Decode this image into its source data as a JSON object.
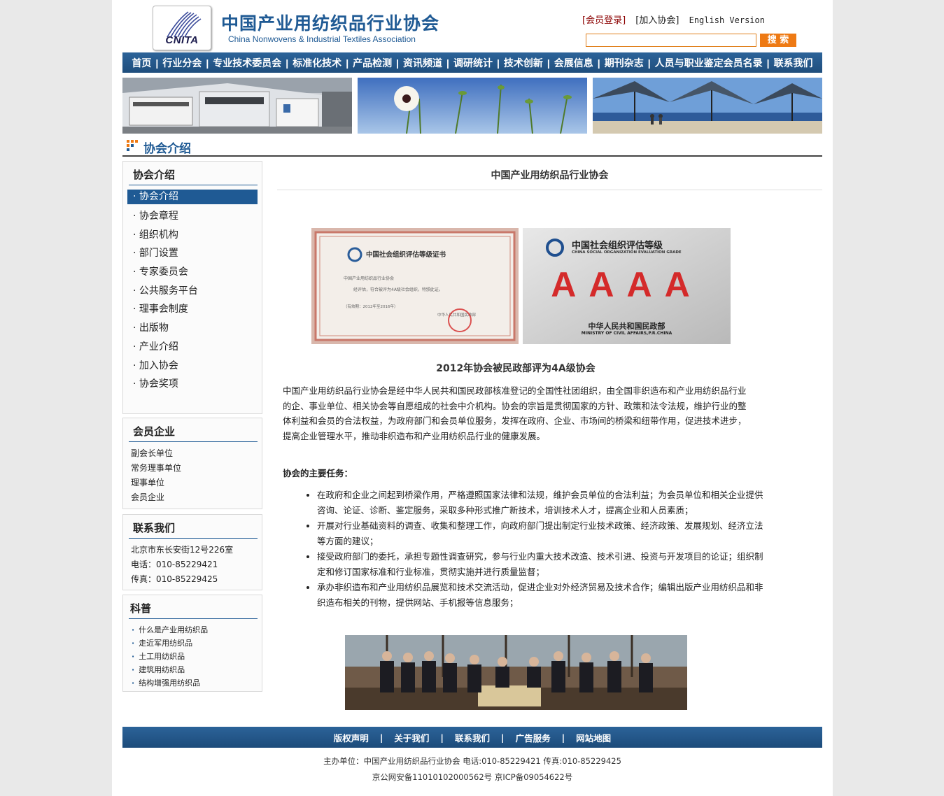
{
  "header": {
    "logo_text": "CNITA",
    "title": "中国产业用纺织品行业协会",
    "subtitle": "China Nonwovens & Industrial Textiles Association",
    "login_link": "[会员登录]",
    "join_link": "[加入协会]",
    "english_link": "English Version",
    "search_placeholder": "",
    "search_button": "搜 索"
  },
  "nav": [
    "首页",
    "行业分会",
    "专业技术委员会",
    "标准化技术",
    "产品检测",
    "资讯频道",
    "调研统计",
    "技术创新",
    "会展信息",
    "期刊杂志",
    "人员与职业鉴定会员名录",
    "联系我们"
  ],
  "nav_separator": "|",
  "section_title": "协会介绍",
  "sidebar": {
    "about": {
      "title": "协会介绍",
      "items": [
        "· 协会介绍",
        "· 协会章程",
        "· 组织机构",
        "· 部门设置",
        "· 专家委员会",
        "· 公共服务平台",
        "· 理事会制度",
        "· 出版物",
        "· 产业介绍",
        "· 加入协会",
        "· 协会奖项"
      ]
    },
    "members": {
      "title": "会员企业",
      "items": [
        "副会长单位",
        "常务理事单位",
        "理事单位",
        "会员企业"
      ]
    },
    "contact": {
      "title": "联系我们",
      "address": "北京市东长安街12号226室",
      "phone": "电话：010-85229421",
      "fax": "传真：010-85229425"
    },
    "science": {
      "title": "科普",
      "items": [
        "什么是产业用纺织品",
        "走近军用纺织品",
        "土工用纺织品",
        "建筑用纺织品",
        "结构增强用纺织品"
      ]
    }
  },
  "main": {
    "title": "中国产业用纺织品行业协会",
    "cert_left": {
      "heading": "中国社会组织评估等级证书",
      "line1": "中国产业用纺织品行业协会",
      "line2": "经评估，符合被评为4A级社会组织，特颁此证。",
      "line3": "（有效期：2012年至2016年）",
      "issuer": "中华人民共和国民政部"
    },
    "cert_right": {
      "heading": "中国社会组织评估等级",
      "heading_en": "CHINA SOCIAL ORGANIZATION EVALUATION GRADE",
      "grade": "AAAA",
      "ministry": "中华人民共和国民政部",
      "ministry_en": "MINISTRY OF CIVIL AFFAIRS,P.R.CHINA"
    },
    "caption": "2012年协会被民政部评为4A级协会",
    "intro": "中国产业用纺织品行业协会是经中华人民共和国民政部核准登记的全国性社团组织，由全国非织造布和产业用纺织品行业的企、事业单位、相关协会等自愿组成的社会中介机构。协会的宗旨是贯彻国家的方针、政策和法令法规，维护行业的整体利益和会员的合法权益，为政府部门和会员单位服务，发挥在政府、企业、市场间的桥梁和纽带作用，促进技术进步，提高企业管理水平，推动非织造布和产业用纺织品行业的健康发展。",
    "tasks_title": "协会的主要任务：",
    "tasks": [
      "在政府和企业之间起到桥梁作用，严格遵照国家法律和法规，维护会员单位的合法利益；为会员单位和相关企业提供咨询、论证、诊断、鉴定服务，采取多种形式推广新技术，培训技术人才，提高企业和人员素质；",
      "开展对行业基础资料的调查、收集和整理工作，向政府部门提出制定行业技术政策、经济政策、发展规划、经济立法等方面的建议；",
      "接受政府部门的委托，承担专题性调查研究，参与行业内重大技术改造、技术引进、投资与开发项目的论证；组织制定和修订国家标准和行业标准，贯彻实施并进行质量监督；",
      " 承办非织造布和产业用纺织品展览和技术交流活动，促进企业对外经济贸易及技术合作；编辑出版产业用纺织品和非织造布相关的刊物，提供网站、手机报等信息服务；"
    ]
  },
  "footer": {
    "links": [
      "版权声明",
      "关于我们",
      "联系我们",
      "广告服务",
      "网站地图"
    ],
    "separator": "|",
    "line1": "主办单位：中国产业用纺织品行业协会 电话:010-85229421 传真:010-85229425",
    "line2": "京公网安备11010102000562号 京ICP备09054622号"
  },
  "colors": {
    "brand_blue": "#1f5a94",
    "nav_blue": "#2c6399",
    "search_orange": "#ee7a14",
    "login_red": "#8b0000",
    "grade_red": "#d42a2a"
  }
}
